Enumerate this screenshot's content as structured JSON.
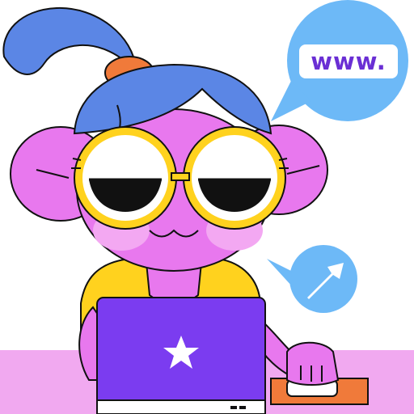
{
  "speech_bubble": {
    "text": "www.",
    "icon": "www-speech-bubble-icon"
  },
  "pointer_bubble": {
    "icon": "arrow-up-right-icon"
  },
  "laptop": {
    "icon": "star-logo-icon"
  },
  "colors": {
    "hair": "#5b86e5",
    "hair_tie": "#f07a3a",
    "skin": "#e878ee",
    "cheek": "#f3a8f2",
    "glasses_frame": "#ffd21e",
    "shirt": "#ffd21e",
    "laptop": "#7b3cf0",
    "desk": "#f1a9f0",
    "mousepad": "#f07a3a",
    "bubble": "#6db9f7",
    "www_text": "#6a2fd4",
    "outline": "#111111"
  }
}
